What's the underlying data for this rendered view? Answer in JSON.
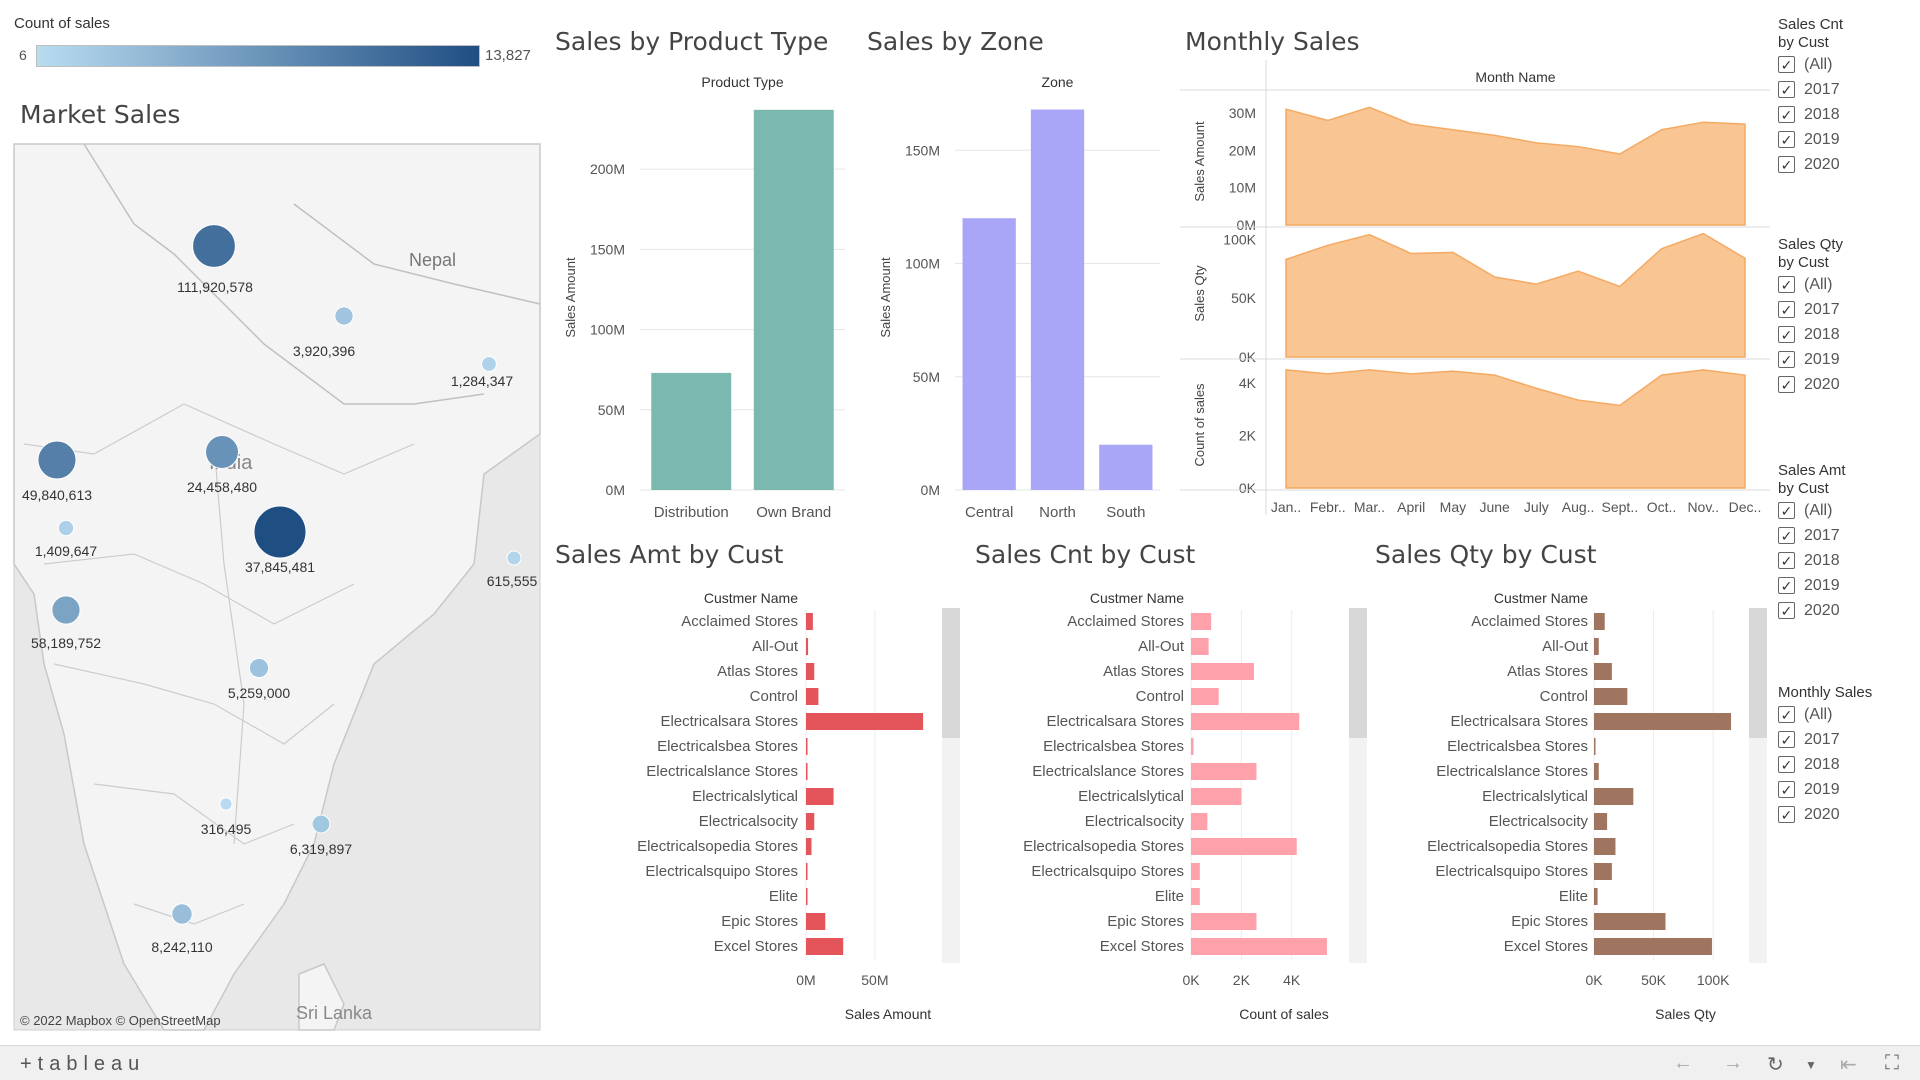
{
  "legend": {
    "title": "Count of sales",
    "min_label": "6",
    "max_label": "13,827",
    "colors": [
      "#b9dcf1",
      "#1f4e83"
    ]
  },
  "titles": {
    "market_sales": "Market Sales",
    "sales_by_product_type": "Sales by Product Type",
    "sales_by_zone": "Sales by Zone",
    "monthly_sales": "Monthly Sales",
    "sales_amt_by_cust": "Sales Amt by Cust",
    "sales_cnt_by_cust": "Sales Cnt by Cust",
    "sales_qty_by_cust": "Sales Qty by Cust"
  },
  "map": {
    "labels": {
      "nepal": "Nepal",
      "india": "India",
      "sri_lanka": "Sri Lanka"
    },
    "credit": "© 2022 Mapbox  © OpenStreetMap"
  },
  "filters": [
    {
      "title_line1": "Sales Cnt",
      "title_line2": "by Cust",
      "options": [
        "(All)",
        "2017",
        "2018",
        "2019",
        "2020"
      ]
    },
    {
      "title_line1": "Sales Qty",
      "title_line2": "by Cust",
      "options": [
        "(All)",
        "2017",
        "2018",
        "2019",
        "2020"
      ]
    },
    {
      "title_line1": "Sales Amt",
      "title_line2": "by Cust",
      "options": [
        "(All)",
        "2017",
        "2018",
        "2019",
        "2020"
      ]
    },
    {
      "title_line1": "Monthly Sales",
      "title_line2": "",
      "options": [
        "(All)",
        "2017",
        "2018",
        "2019",
        "2020"
      ]
    }
  ],
  "footer": {
    "logo": "+tableau"
  },
  "chart_data": [
    {
      "id": "market_sales_map",
      "type": "scatter",
      "title": "Market Sales",
      "color_legend": "Count of sales",
      "points": [
        {
          "label": "111,920,578",
          "count": 9500
        },
        {
          "label": "3,920,396",
          "count": 1000
        },
        {
          "label": "1,284,347",
          "count": 300
        },
        {
          "label": "49,840,613",
          "count": 7500
        },
        {
          "label": "24,458,480",
          "count": 5500
        },
        {
          "label": "37,845,481",
          "count": 13827
        },
        {
          "label": "1,409,647",
          "count": 400
        },
        {
          "label": "615,555",
          "count": 200
        },
        {
          "label": "58,189,752",
          "count": 3800
        },
        {
          "label": "5,259,000",
          "count": 1200
        },
        {
          "label": "316,495",
          "count": 6
        },
        {
          "label": "6,319,897",
          "count": 900
        },
        {
          "label": "8,242,110",
          "count": 1500
        }
      ]
    },
    {
      "id": "sales_by_product_type",
      "type": "bar",
      "title": "Sales by Product Type",
      "header": "Product Type",
      "categories": [
        "Distribution",
        "Own Brand"
      ],
      "values": [
        73,
        237
      ],
      "ylabel": "Sales Amount",
      "ylim": [
        0,
        240
      ],
      "yticks": [
        "0M",
        "50M",
        "100M",
        "150M",
        "200M"
      ],
      "tick_values": [
        0,
        50,
        100,
        150,
        200
      ],
      "color": "#7ab8b0"
    },
    {
      "id": "sales_by_zone",
      "type": "bar",
      "title": "Sales by Zone",
      "header": "Zone",
      "categories": [
        "Central",
        "North",
        "South"
      ],
      "values": [
        120,
        168,
        20
      ],
      "ylabel": "Sales Amount",
      "ylim": [
        0,
        170
      ],
      "yticks": [
        "0M",
        "50M",
        "100M",
        "150M"
      ],
      "tick_values": [
        0,
        50,
        100,
        150
      ],
      "color": "#a9a6f7"
    },
    {
      "id": "monthly_sales",
      "type": "area",
      "title": "Monthly Sales",
      "header": "Month Name",
      "categories": [
        "Jan..",
        "Febr..",
        "Mar..",
        "April",
        "May",
        "June",
        "July",
        "Aug..",
        "Sept..",
        "Oct..",
        "Nov..",
        "Dec.."
      ],
      "color": "#f8bf86",
      "series": [
        {
          "name": "Sales Amount",
          "values": [
            31,
            28,
            31.5,
            27,
            25.5,
            24,
            22,
            21,
            19,
            25.5,
            27.5,
            27
          ],
          "ylim": [
            0,
            34
          ],
          "yticks": [
            "0M",
            "10M",
            "20M",
            "30M"
          ],
          "tick_values": [
            0,
            10,
            20,
            30
          ]
        },
        {
          "name": "Sales Qty",
          "values": [
            83000,
            95000,
            104000,
            88000,
            89000,
            68000,
            62000,
            73000,
            60000,
            92000,
            105000,
            84000
          ],
          "ylim": [
            0,
            108000
          ],
          "yticks": [
            "0K",
            "50K",
            "100K"
          ],
          "tick_values": [
            0,
            50000,
            100000
          ]
        },
        {
          "name": "Count of sales",
          "values": [
            4500,
            4350,
            4500,
            4350,
            4450,
            4300,
            3800,
            3350,
            3150,
            4300,
            4500,
            4300
          ],
          "ylim": [
            0,
            4800
          ],
          "yticks": [
            "0K",
            "2K",
            "4K"
          ],
          "tick_values": [
            0,
            2000,
            4000
          ]
        }
      ]
    },
    {
      "id": "sales_amt_by_cust",
      "type": "bar",
      "orientation": "horizontal",
      "title": "Sales Amt by Cust",
      "header": "Custmer Name",
      "xlabel": "Sales Amount",
      "categories": [
        "Acclaimed Stores",
        "All-Out",
        "Atlas Stores",
        "Control",
        "Electricalsara Stores",
        "Electricalsbea Stores",
        "Electricalslance Stores",
        "Electricalslytical",
        "Electricalsocity",
        "Electricalsopedia Stores",
        "Electricalsquipo Stores",
        "Elite",
        "Epic Stores",
        "Excel Stores"
      ],
      "values": [
        5,
        1.5,
        6,
        9,
        85,
        0.3,
        0.5,
        20,
        6,
        4,
        0.3,
        0.8,
        14,
        27
      ],
      "xlim": [
        0,
        90
      ],
      "xticks": [
        "0M",
        "50M"
      ],
      "tick_values": [
        0,
        50
      ],
      "color": "#e3555a"
    },
    {
      "id": "sales_cnt_by_cust",
      "type": "bar",
      "orientation": "horizontal",
      "title": "Sales Cnt by Cust",
      "header": "Custmer Name",
      "xlabel": "Count of sales",
      "categories": [
        "Acclaimed Stores",
        "All-Out",
        "Atlas Stores",
        "Control",
        "Electricalsara Stores",
        "Electricalsbea Stores",
        "Electricalslance Stores",
        "Electricalslytical",
        "Electricalsocity",
        "Electricalsopedia Stores",
        "Electricalsquipo Stores",
        "Elite",
        "Epic Stores",
        "Excel Stores"
      ],
      "values": [
        800,
        700,
        2500,
        1100,
        4300,
        100,
        2600,
        2000,
        650,
        4200,
        350,
        350,
        2600,
        5400
      ],
      "xlim": [
        0,
        5800
      ],
      "xticks": [
        "0K",
        "2K",
        "4K"
      ],
      "tick_values": [
        0,
        2000,
        4000
      ],
      "color": "#fea1ab"
    },
    {
      "id": "sales_qty_by_cust",
      "type": "bar",
      "orientation": "horizontal",
      "title": "Sales Qty by Cust",
      "header": "Custmer Name",
      "xlabel": "Sales Qty",
      "categories": [
        "Acclaimed Stores",
        "All-Out",
        "Atlas Stores",
        "Control",
        "Electricalsara Stores",
        "Electricalsbea Stores",
        "Electricalslance Stores",
        "Electricalslytical",
        "Electricalsocity",
        "Electricalsopedia Stores",
        "Electricalsquipo Stores",
        "Elite",
        "Epic Stores",
        "Excel Stores"
      ],
      "values": [
        9000,
        4000,
        15000,
        28000,
        115000,
        1000,
        4000,
        33000,
        11000,
        18000,
        15000,
        3000,
        60000,
        99000
      ],
      "xlim": [
        0,
        120000
      ],
      "xticks": [
        "0K",
        "50K",
        "100K"
      ],
      "tick_values": [
        0,
        50000,
        100000
      ],
      "color": "#a07560"
    }
  ]
}
